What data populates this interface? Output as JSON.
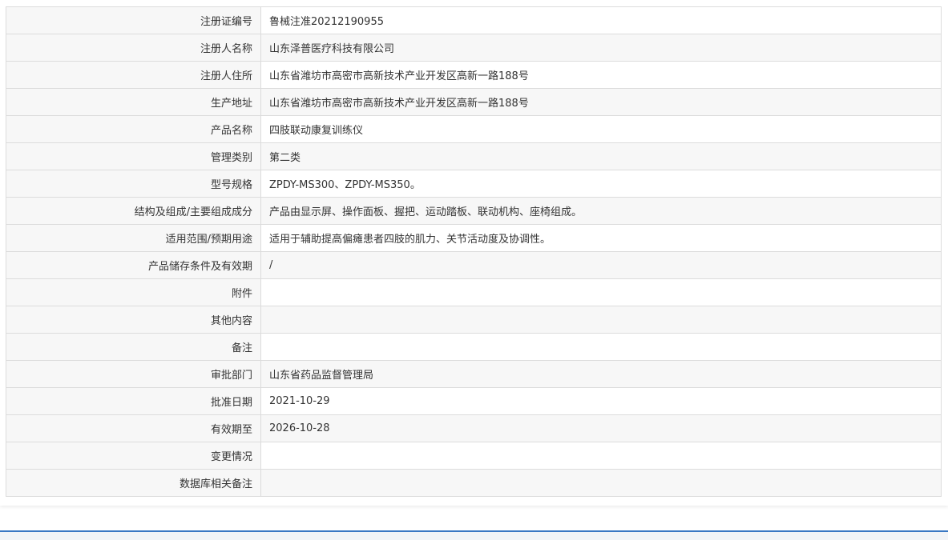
{
  "record": {
    "rows": [
      {
        "label": "注册证编号",
        "value": "鲁械注准20212190955"
      },
      {
        "label": "注册人名称",
        "value": "山东泽普医疗科技有限公司"
      },
      {
        "label": "注册人住所",
        "value": "山东省潍坊市高密市高新技术产业开发区高新一路188号"
      },
      {
        "label": "生产地址",
        "value": "山东省潍坊市高密市高新技术产业开发区高新一路188号"
      },
      {
        "label": "产品名称",
        "value": "四肢联动康复训练仪"
      },
      {
        "label": "管理类别",
        "value": "第二类"
      },
      {
        "label": "型号规格",
        "value": "ZPDY-MS300、ZPDY-MS350。"
      },
      {
        "label": "结构及组成/主要组成成分",
        "value": "产品由显示屏、操作面板、握把、运动踏板、联动机构、座椅组成。"
      },
      {
        "label": "适用范围/预期用途",
        "value": "适用于辅助提高偏瘫患者四肢的肌力、关节活动度及协调性。"
      },
      {
        "label": "产品储存条件及有效期",
        "value": "/"
      },
      {
        "label": "附件",
        "value": ""
      },
      {
        "label": "其他内容",
        "value": ""
      },
      {
        "label": "备注",
        "value": ""
      },
      {
        "label": "审批部门",
        "value": "山东省药品监督管理局"
      },
      {
        "label": "批准日期",
        "value": "2021-10-29"
      },
      {
        "label": "有效期至",
        "value": "2026-10-28"
      },
      {
        "label": "变更情况",
        "value": ""
      },
      {
        "label": "数据库相关备注",
        "value": ""
      }
    ]
  },
  "colors": {
    "label_bg": "#f7f7f7",
    "border": "#dcdcdc",
    "text": "#333333",
    "footer_accent": "#3a78c3"
  }
}
